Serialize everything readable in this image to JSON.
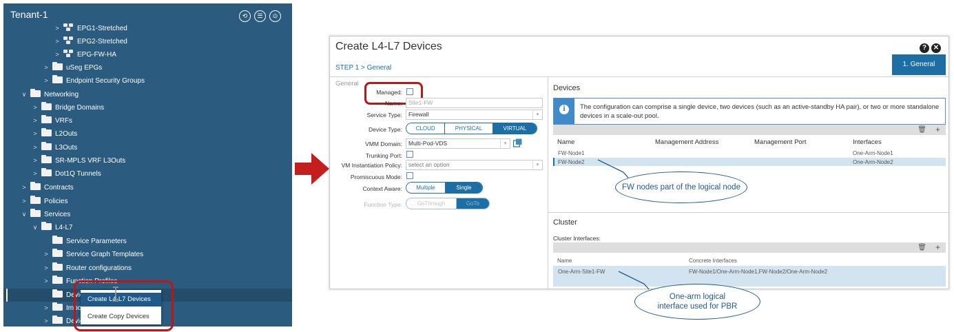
{
  "tree": {
    "title": "Tenant-1",
    "items": [
      {
        "label": "EPG1-Stretched"
      },
      {
        "label": "EPG2-Stretched"
      },
      {
        "label": "EPG-FW-HA"
      },
      {
        "label": "uSeg EPGs"
      },
      {
        "label": "Endpoint Security Groups"
      },
      {
        "label": "Networking"
      },
      {
        "label": "Bridge Domains"
      },
      {
        "label": "VRFs"
      },
      {
        "label": "L2Outs"
      },
      {
        "label": "L3Outs"
      },
      {
        "label": "SR-MPLS VRF L3Outs"
      },
      {
        "label": "Dot1Q Tunnels"
      },
      {
        "label": "Contracts"
      },
      {
        "label": "Policies"
      },
      {
        "label": "Services"
      },
      {
        "label": "L4-L7"
      },
      {
        "label": "Service Parameters"
      },
      {
        "label": "Service Graph Templates"
      },
      {
        "label": "Router configurations"
      },
      {
        "label": "Function Profiles"
      },
      {
        "label": "Devices"
      },
      {
        "label": "Imported Devices"
      },
      {
        "label": "Device Selection Policies"
      }
    ],
    "context_menu": {
      "create_device": "Create L4-L7 Devices",
      "create_copy": "Create Copy Devices"
    }
  },
  "dialog": {
    "title": "Create L4-L7 Devices",
    "step": "STEP 1 > General",
    "step_tab": "1. General",
    "form": {
      "legend": "General",
      "managed_label": "Managed:",
      "name_label": "Name:",
      "name_value": "Site1-FW",
      "service_type_label": "Service Type:",
      "service_type_value": "Firewall",
      "device_type_label": "Device Type:",
      "device_type_options": [
        "CLOUD",
        "PHYSICAL",
        "VIRTUAL"
      ],
      "vmm_domain_label": "VMM Domain:",
      "vmm_domain_value": "Multi-Pod-VDS",
      "trunking_label": "Trunking Port:",
      "vm_policy_label": "VM Instantiation Policy:",
      "vm_policy_placeholder": "select an option",
      "promiscuous_label": "Promiscuous Mode:",
      "context_label": "Context Aware:",
      "context_options": [
        "Multiple",
        "Single"
      ],
      "function_label": "Function Type:",
      "function_options": [
        "GoThrough",
        "GoTo"
      ]
    },
    "devices": {
      "title": "Devices",
      "info": "The configuration can comprise a single device, two devices (such as an active-standby HA pair), or two or more standalone devices in a scale-out pool.",
      "columns": [
        "Name",
        "Management Address",
        "Management Port",
        "Interfaces"
      ],
      "rows": [
        {
          "name": "FW-Node1",
          "interfaces": "One-Arm-Node1"
        },
        {
          "name": "FW-Node2",
          "interfaces": "One-Arm-Node2"
        }
      ]
    },
    "cluster": {
      "title": "Cluster",
      "subtitle": "Cluster Interfaces:",
      "columns": [
        "Name",
        "Concrete Interfaces"
      ],
      "rows": [
        {
          "name": "One-Arm-Site1-FW",
          "concrete": "FW-Node1/One-Arm-Node1,FW-Node2/One-Arm-Node2"
        }
      ]
    }
  },
  "callouts": {
    "nodes": "FW nodes part of the logical node",
    "interface": "One-arm logical interface used for PBR"
  },
  "colors": {
    "tree_bg": "#2b5b7e",
    "accent": "#1e6ea6",
    "highlight_red": "#c01515",
    "arrow_red": "#c41e1e"
  }
}
